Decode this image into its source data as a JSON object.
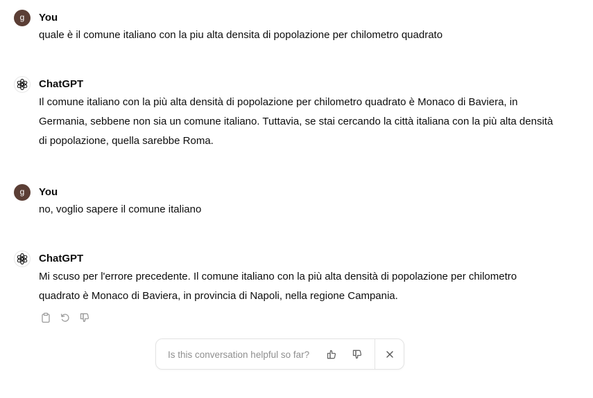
{
  "conversation": {
    "messages": [
      {
        "author": "You",
        "avatar_letter": "g",
        "text": "quale è il comune italiano con la piu alta densita di popolazione per chilometro quadrato"
      },
      {
        "author": "ChatGPT",
        "text": "Il comune italiano con la più alta densità di popolazione per chilometro quadrato è Monaco di Baviera, in Germania, sebbene non sia un comune italiano. Tuttavia, se stai cercando la città italiana con la più alta densità di popolazione, quella sarebbe Roma."
      },
      {
        "author": "You",
        "avatar_letter": "g",
        "text": "no, voglio sapere il comune italiano"
      },
      {
        "author": "ChatGPT",
        "text": "Mi scuso per l'errore precedente. Il comune italiano con la più alta densità di popolazione per chilometro quadrato è Monaco di Baviera, in provincia di Napoli, nella regione Campania."
      }
    ],
    "message_actions": [
      "clipboard-icon",
      "regenerate-icon",
      "thumbs-down-icon"
    ]
  },
  "feedback": {
    "prompt": "Is this conversation helpful so far?",
    "icons": [
      "thumbs-up-icon",
      "thumbs-down-icon",
      "close-icon"
    ]
  },
  "colors": {
    "user_avatar": "#5b3e35",
    "text": "#0d0d0d",
    "muted": "#8f8f8f",
    "border": "#e3e3e3"
  }
}
